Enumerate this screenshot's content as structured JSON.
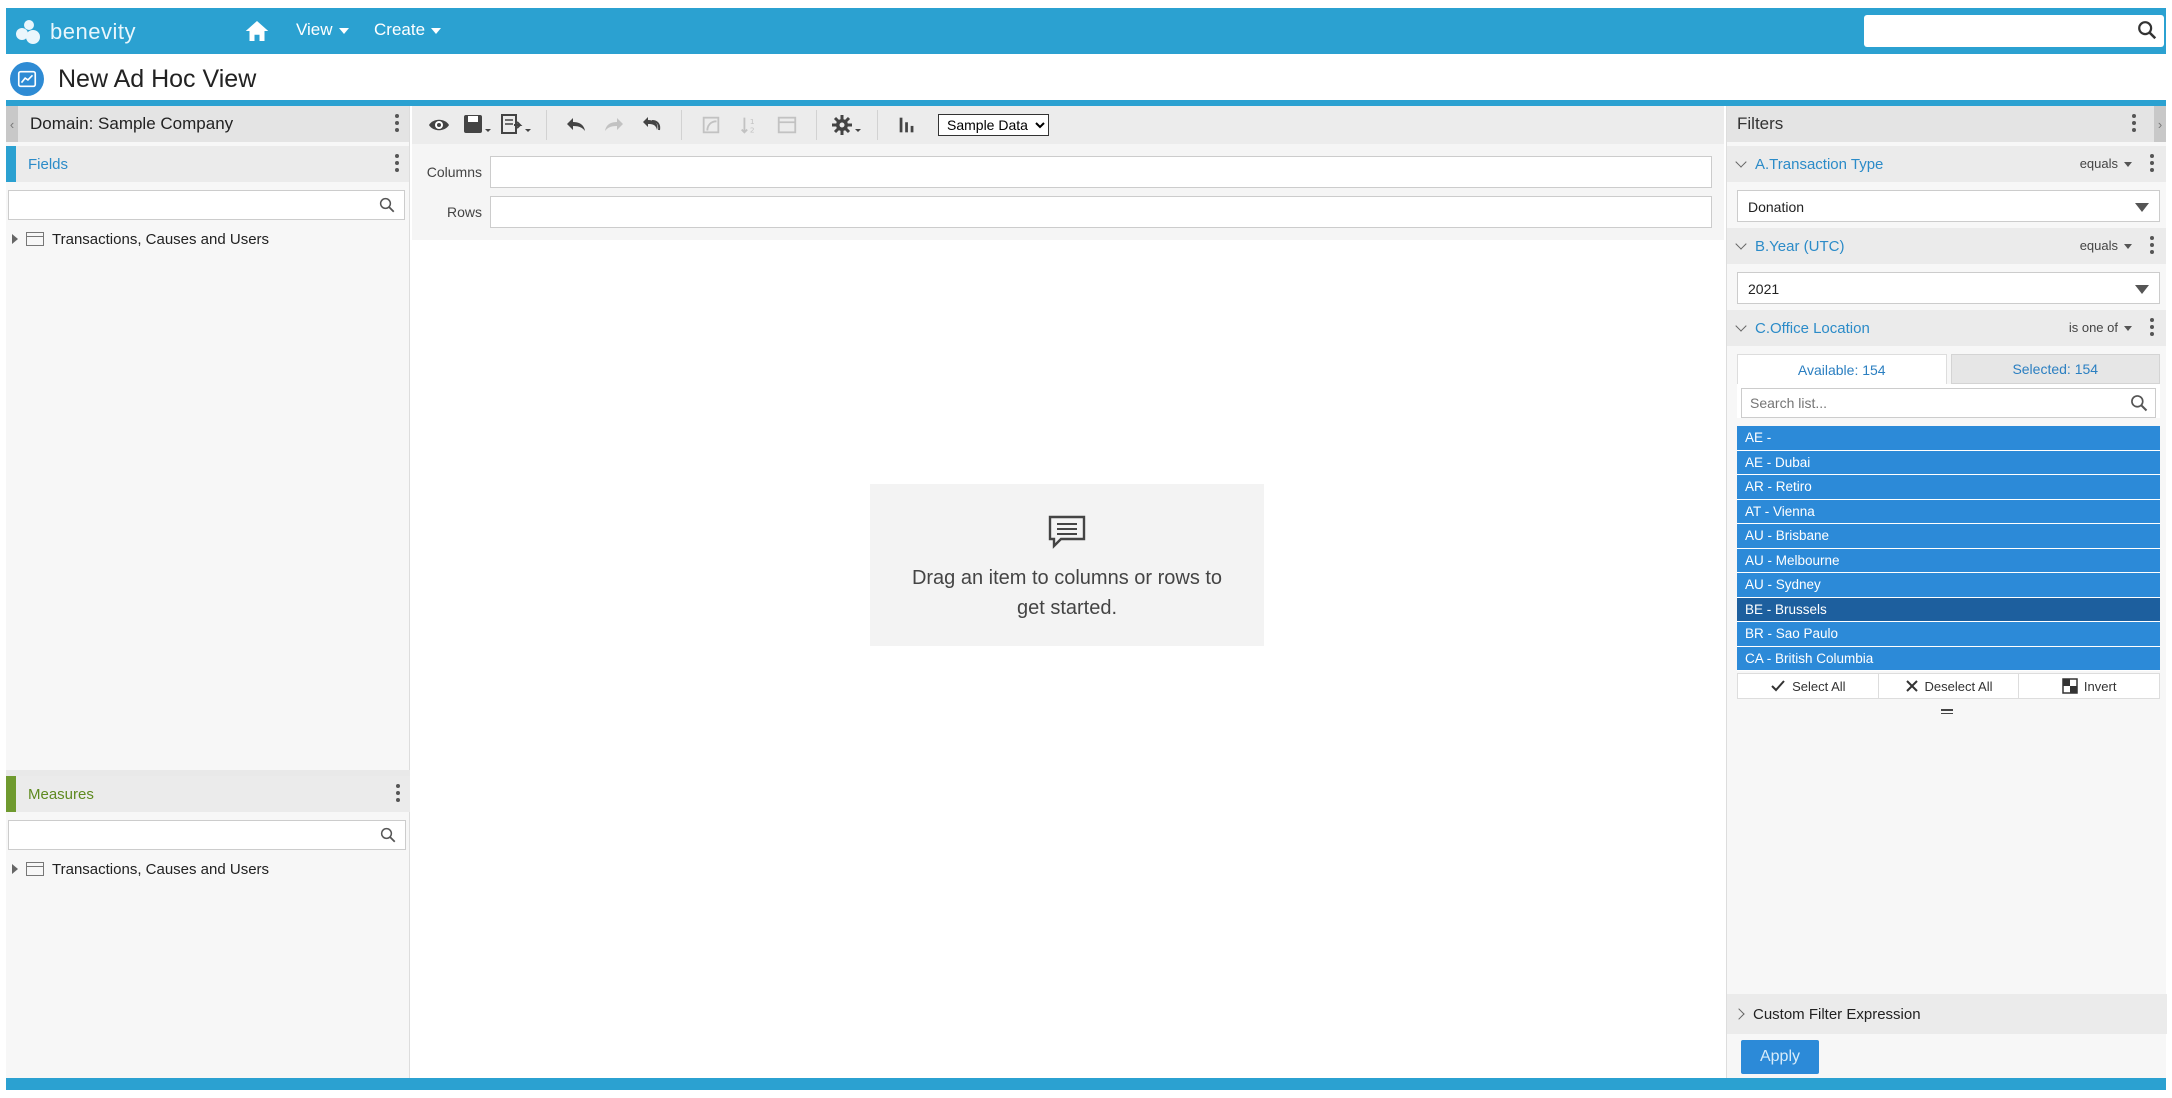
{
  "app": {
    "logo_text": "benevity",
    "nav": {
      "view_label": "View",
      "create_label": "Create"
    },
    "search": {
      "value": "",
      "placeholder": ""
    }
  },
  "page": {
    "title": "New Ad Hoc View"
  },
  "left_panel": {
    "domain_label": "Domain: Sample Company",
    "fields": {
      "title": "Fields",
      "search_value": "",
      "tree": [
        "Transactions, Causes and Users"
      ],
      "accent": "#2ba1d1"
    },
    "measures": {
      "title": "Measures",
      "search_value": "",
      "tree": [
        "Transactions, Causes and Users"
      ],
      "accent": "#6f9a2f"
    }
  },
  "toolbar": {
    "icons": [
      "eye-icon",
      "save-icon",
      "export-icon",
      "undo-icon",
      "redo-icon",
      "undo-all-icon",
      "switch-icon",
      "sort-icon",
      "table-icon",
      "gear-icon",
      "chart-icon"
    ],
    "data_select": {
      "selected": "Sample Data",
      "options": [
        "Sample Data"
      ]
    }
  },
  "drop_zones": {
    "columns_label": "Columns",
    "rows_label": "Rows"
  },
  "empty_state": {
    "message": "Drag an item to columns or rows to get started."
  },
  "filters": {
    "title": "Filters",
    "items": [
      {
        "name": "A.Transaction Type",
        "operator": "equals",
        "value": "Donation"
      },
      {
        "name": "B.Year (UTC)",
        "operator": "equals",
        "value": "2021"
      },
      {
        "name": "C.Office Location",
        "operator": "is one of",
        "available_label": "Available: 154",
        "selected_label": "Selected: 154",
        "search_placeholder": "Search list...",
        "options": [
          "AE -",
          "AE - Dubai",
          "AR - Retiro",
          "AT - Vienna",
          "AU - Brisbane",
          "AU - Melbourne",
          "AU - Sydney",
          "BE - Brussels",
          "BR - Sao Paulo",
          "CA - British Columbia"
        ],
        "actions": {
          "select_all": "Select All",
          "deselect_all": "Deselect All",
          "invert": "Invert"
        }
      }
    ],
    "custom_expression_label": "Custom Filter Expression",
    "apply_label": "Apply"
  },
  "colors": {
    "brand": "#2ba1d1",
    "selected_option": "#2c8ad8",
    "highlighted_option": "#1d5f9e",
    "filter_link": "#2b8bc8"
  }
}
